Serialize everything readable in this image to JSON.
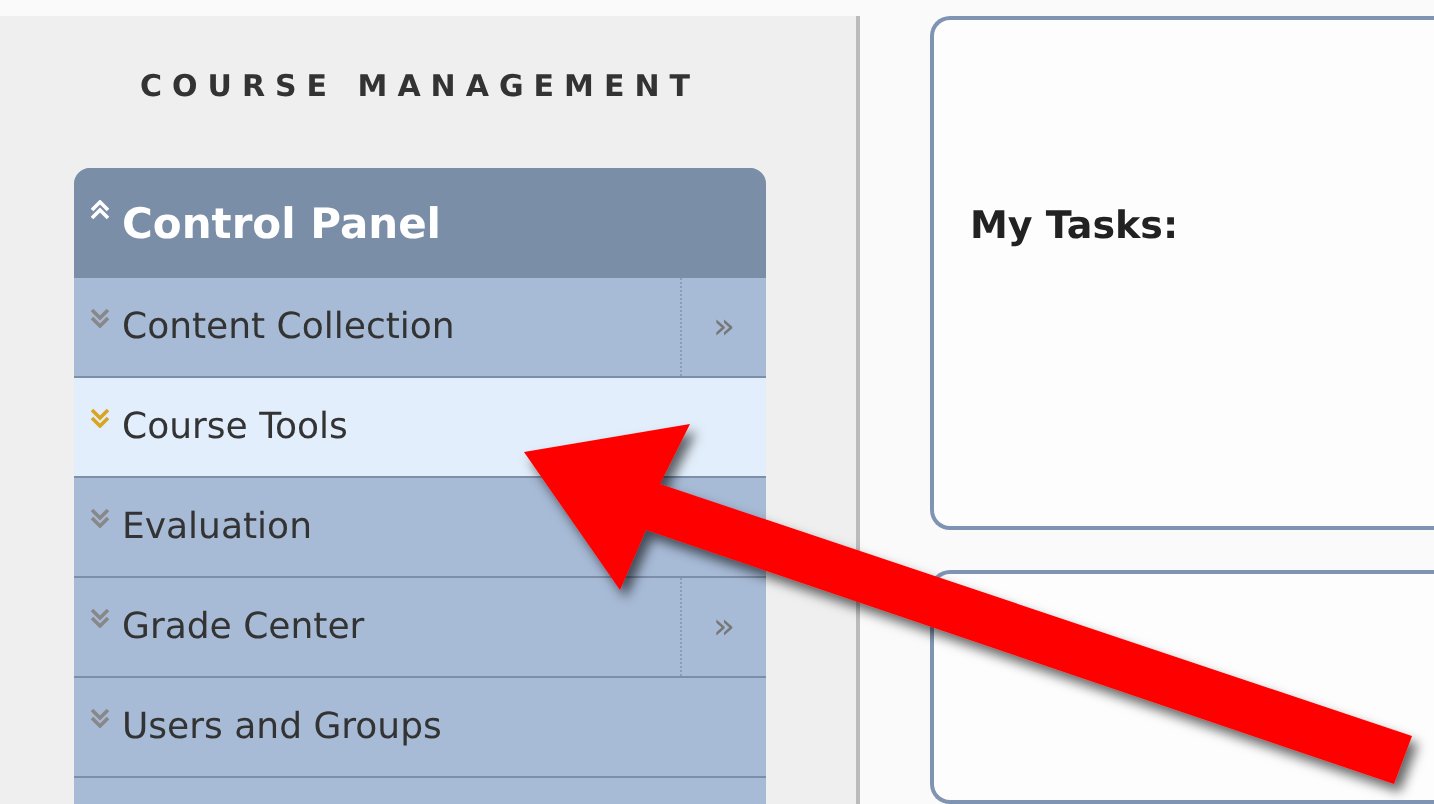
{
  "sidebar": {
    "title": "COURSE MANAGEMENT",
    "panel": {
      "title": "Control Panel",
      "expanded": true,
      "items": [
        {
          "label": "Content Collection",
          "selected": false,
          "submenu": "»"
        },
        {
          "label": "Course Tools",
          "selected": true
        },
        {
          "label": "Evaluation",
          "selected": false
        },
        {
          "label": "Grade Center",
          "selected": false,
          "submenu": "»"
        },
        {
          "label": "Users and Groups",
          "selected": false
        }
      ]
    }
  },
  "main": {
    "modules": [
      {
        "kind": "titled",
        "title": "My Tasks:"
      },
      {
        "kind": "blank"
      }
    ]
  }
}
